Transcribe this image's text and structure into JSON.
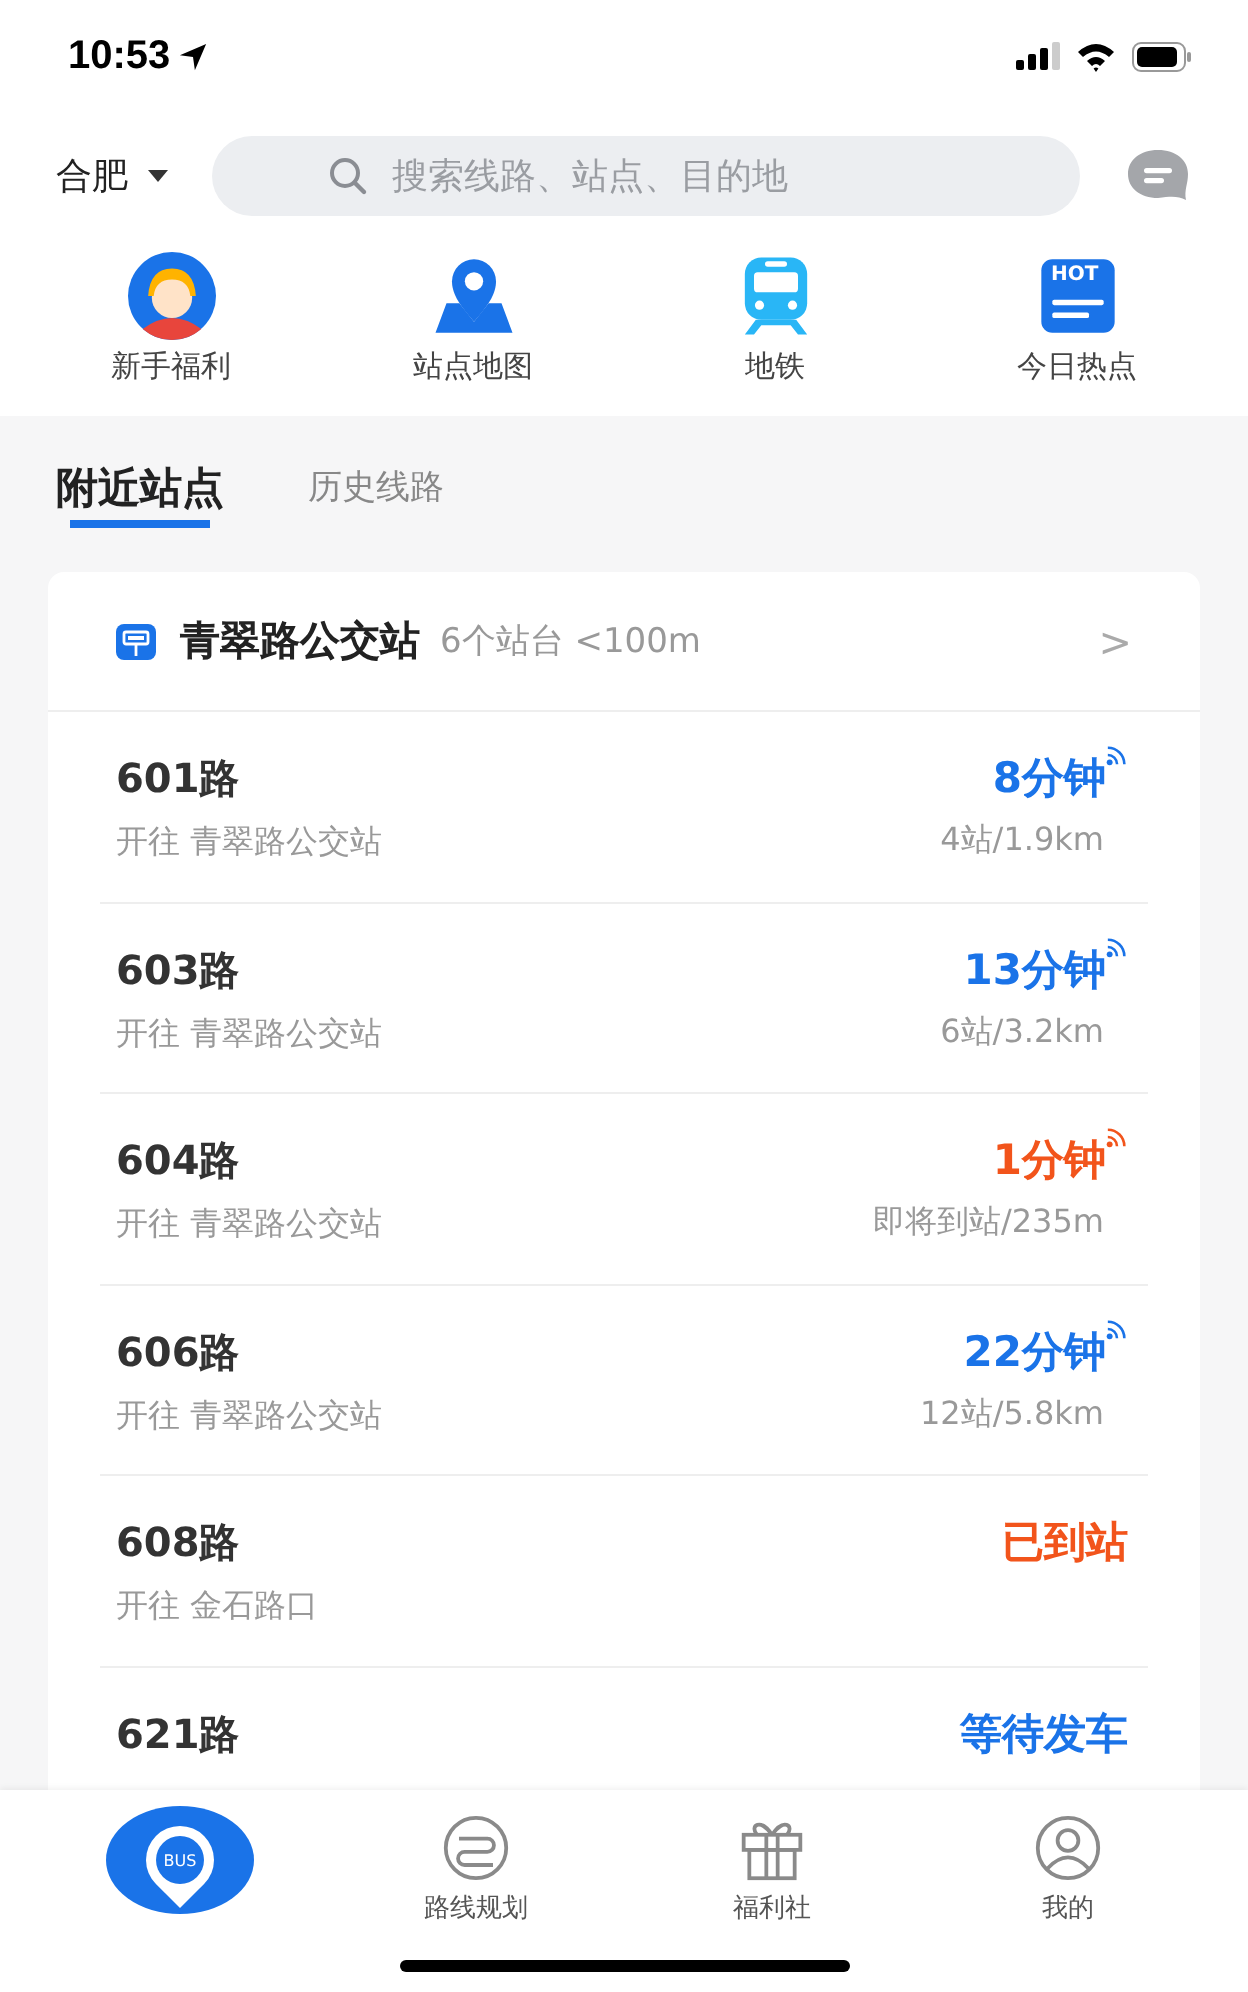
{
  "status_bar": {
    "time": "10:53"
  },
  "header": {
    "city": "合肥",
    "search": {
      "placeholder": "搜索线路、站点、目的地"
    }
  },
  "shortcuts": [
    {
      "kind": "welfare",
      "label": "新手福利"
    },
    {
      "kind": "map",
      "label": "站点地图"
    },
    {
      "kind": "metro",
      "label": "地铁"
    },
    {
      "kind": "hot",
      "label": "今日热点",
      "badge": "HOT"
    }
  ],
  "tabs": [
    {
      "label": "附近站点",
      "selected": true
    },
    {
      "label": "历史线路",
      "selected": false
    }
  ],
  "station": {
    "name": "青翠路公交站",
    "info": "6个站台 <100m",
    "chevron": ">"
  },
  "routes": [
    {
      "name": "601路",
      "direction": "开往 青翠路公交站",
      "eta": "8分钟",
      "live": true,
      "color": "#1a73e8",
      "detail": "4站/1.9km"
    },
    {
      "name": "603路",
      "direction": "开往 青翠路公交站",
      "eta": "13分钟",
      "live": true,
      "color": "#1a73e8",
      "detail": "6站/3.2km"
    },
    {
      "name": "604路",
      "direction": "开往 青翠路公交站",
      "eta": "1分钟",
      "live": true,
      "color": "#f2541b",
      "detail": "即将到站/235m"
    },
    {
      "name": "606路",
      "direction": "开往 青翠路公交站",
      "eta": "22分钟",
      "live": true,
      "color": "#1a73e8",
      "detail": "12站/5.8km"
    },
    {
      "name": "608路",
      "direction": "开往 金石路口",
      "eta": "已到站",
      "live": false,
      "color": "#f2541b"
    },
    {
      "name": "621路",
      "eta": "等待发车",
      "live": false,
      "color": "#1a73e8"
    }
  ],
  "tab_bar": [
    {
      "kind": "bus",
      "label": "BUS",
      "selected": true
    },
    {
      "kind": "route",
      "label": "路线规划",
      "selected": false
    },
    {
      "kind": "gift",
      "label": "福利社",
      "selected": false
    },
    {
      "kind": "user",
      "label": "我的",
      "selected": false
    }
  ]
}
